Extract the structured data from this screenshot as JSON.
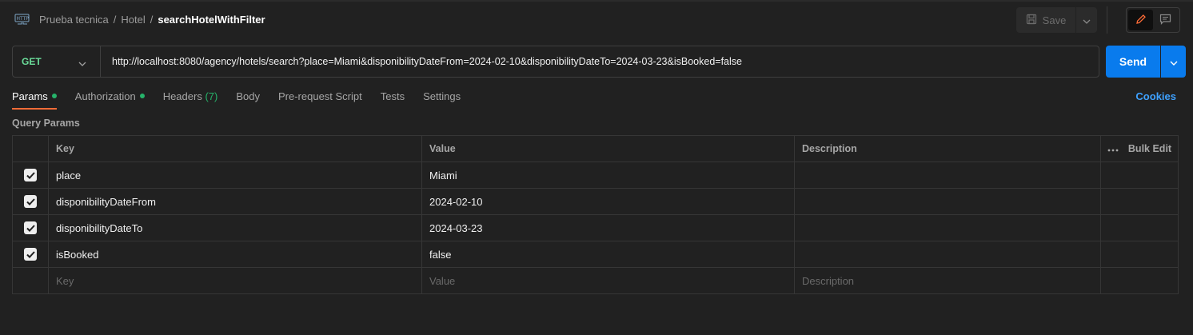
{
  "colors": {
    "background": "#212121",
    "accent_send": "#097bed",
    "method_get": "#6bdd9a",
    "tab_underline": "#ff6c37",
    "indicator_green": "#26b36a",
    "link_blue": "#3ea1ff"
  },
  "header": {
    "icon": "http-icon",
    "breadcrumb": [
      "Prueba tecnica",
      "Hotel",
      "searchHotelWithFilter"
    ],
    "save_label": "Save"
  },
  "request": {
    "method": "GET",
    "url": "http://localhost:8080/agency/hotels/search?place=Miami&disponibilityDateFrom=2024-02-10&disponibilityDateTo=2024-03-23&isBooked=false",
    "send_label": "Send"
  },
  "tabs": [
    {
      "label": "Params",
      "active": true,
      "dot": true
    },
    {
      "label": "Authorization",
      "active": false,
      "dot": true
    },
    {
      "label": "Headers",
      "count": "(7)",
      "active": false
    },
    {
      "label": "Body",
      "active": false
    },
    {
      "label": "Pre-request Script",
      "active": false
    },
    {
      "label": "Tests",
      "active": false
    },
    {
      "label": "Settings",
      "active": false
    }
  ],
  "cookies_label": "Cookies",
  "params": {
    "title": "Query Params",
    "columns": {
      "key": "Key",
      "value": "Value",
      "description": "Description",
      "bulk_edit": "Bulk Edit"
    },
    "rows": [
      {
        "checked": true,
        "key": "place",
        "value": "Miami",
        "description": ""
      },
      {
        "checked": true,
        "key": "disponibilityDateFrom",
        "value": "2024-02-10",
        "description": ""
      },
      {
        "checked": true,
        "key": "disponibilityDateTo",
        "value": "2024-03-23",
        "description": ""
      },
      {
        "checked": true,
        "key": "isBooked",
        "value": "false",
        "description": ""
      }
    ],
    "placeholder": {
      "key": "Key",
      "value": "Value",
      "description": "Description"
    }
  }
}
